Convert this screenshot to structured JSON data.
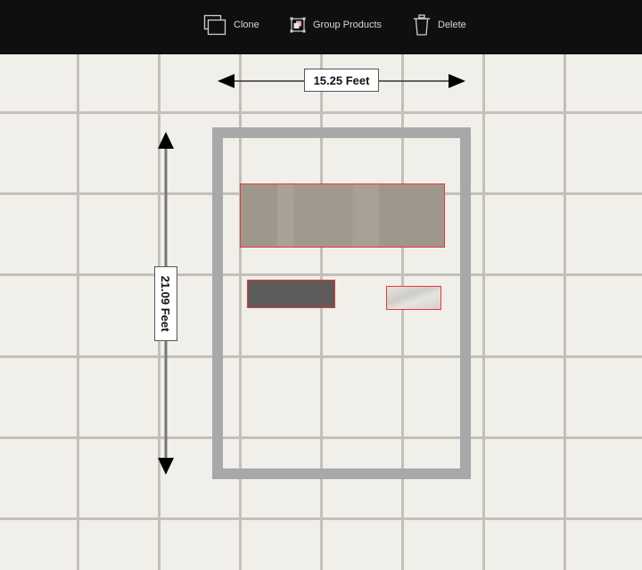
{
  "toolbar": {
    "actions": [
      {
        "id": "clone",
        "label": "Clone",
        "icon": "clone-icon"
      },
      {
        "id": "group",
        "label": "Group Products",
        "icon": "group-products-icon"
      },
      {
        "id": "delete",
        "label": "Delete",
        "icon": "trash-icon"
      }
    ]
  },
  "floor_plan": {
    "width_label": "15.25 Feet",
    "height_label": "21.09 Feet",
    "products": [
      {
        "name": "vanity",
        "selected": true
      },
      {
        "name": "dark-cabinet",
        "selected": true
      },
      {
        "name": "marble-piece",
        "selected": true
      }
    ]
  },
  "colors": {
    "toolbar_bg": "#0f0f0f",
    "canvas_bg": "#f1efea",
    "grid_line": "#c3c0b9",
    "room_wall": "#a8a8a8",
    "selection": "#e53a3a"
  }
}
